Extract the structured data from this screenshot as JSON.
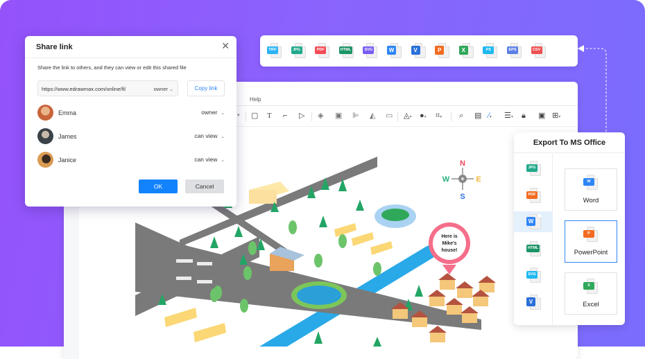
{
  "share_dialog": {
    "title": "Share link",
    "close_icon": "close-icon",
    "description": "Share the link to others, and they can view or edit this shared file",
    "link_url": "https://www.edrawmax.com/online/fil",
    "link_permission": "owner",
    "copy_label": "Copy link",
    "users": [
      {
        "name": "Emma",
        "permission": "owner",
        "avatar_color": "#c9643a"
      },
      {
        "name": "James",
        "permission": "can view",
        "avatar_color": "#3a4247"
      },
      {
        "name": "Janice",
        "permission": "can view",
        "avatar_color": "#c98b45"
      }
    ],
    "ok_label": "OK",
    "cancel_label": "Cancel"
  },
  "editor": {
    "menu_help": "Help",
    "toolbar_icons": [
      "rectangle-icon",
      "text-icon",
      "connector-icon",
      "pointer-icon",
      "layers-icon",
      "group-icon",
      "align-icon",
      "flip-icon",
      "frame-icon",
      "fill-icon",
      "shape-style-icon",
      "crop-icon",
      "search-icon",
      "format-painter-icon",
      "line-color-icon",
      "line-style-icon",
      "lock-icon",
      "fullscreen-icon",
      "more-icon"
    ]
  },
  "formats_bar": {
    "items": [
      {
        "label": "TIFF",
        "color": "#2ab3f4"
      },
      {
        "label": "JPG",
        "color": "#20a98a"
      },
      {
        "label": "PDF",
        "color": "#f44b56"
      },
      {
        "label": "HTML",
        "color": "#1c9466"
      },
      {
        "label": "SVG",
        "color": "#7a5cf2"
      },
      {
        "label": "W",
        "color": "#2f86f6"
      },
      {
        "label": "V",
        "color": "#2b6fd8"
      },
      {
        "label": "P",
        "color": "#f26b20"
      },
      {
        "label": "X",
        "color": "#2fa85a"
      },
      {
        "label": "PS",
        "color": "#1fb9ef"
      },
      {
        "label": "EPS",
        "color": "#5b7fe6"
      },
      {
        "label": "CSV",
        "color": "#ee5050"
      }
    ]
  },
  "export_panel": {
    "title": "Export To MS Office",
    "side_items": [
      {
        "label": "JPG",
        "color": "#20a98a",
        "active": false
      },
      {
        "label": "PDF",
        "color": "#f26b20",
        "active": false
      },
      {
        "label": "W",
        "color": "#2f86f6",
        "active": true
      },
      {
        "label": "HTML",
        "color": "#1c9466",
        "active": false
      },
      {
        "label": "SVG",
        "color": "#1fb9ef",
        "active": false
      },
      {
        "label": "V",
        "color": "#2b6fd8",
        "active": false
      }
    ],
    "cards": [
      {
        "label": "Word",
        "tag": "W",
        "color": "#2f86f6",
        "selected": false
      },
      {
        "label": "PowerPoint",
        "tag": "P",
        "color": "#f26b20",
        "selected": true
      },
      {
        "label": "Excel",
        "tag": "X",
        "color": "#2fa85a",
        "selected": false
      }
    ]
  },
  "map": {
    "compass": {
      "n": "N",
      "s": "S",
      "e": "E",
      "w": "W"
    },
    "callout": [
      "Here is",
      "Mike's",
      "house!"
    ]
  }
}
